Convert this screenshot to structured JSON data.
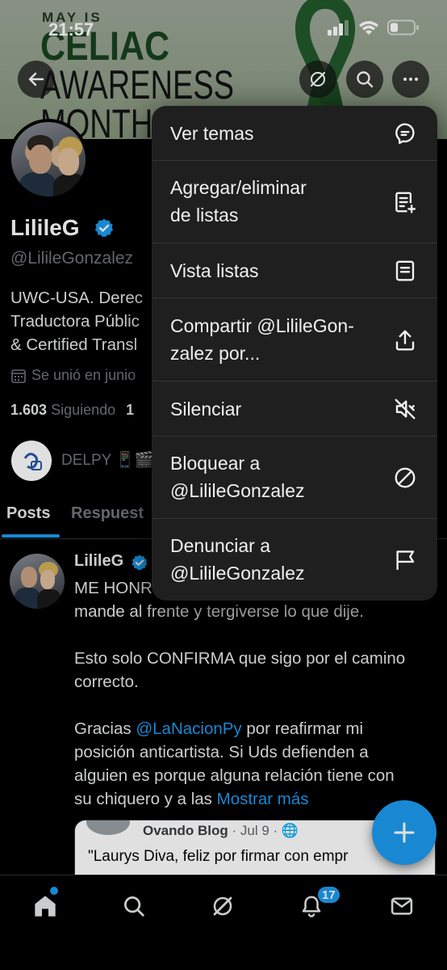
{
  "status_bar": {
    "time": "21:57"
  },
  "banner": {
    "line_small": "MAY IS",
    "line_1": "CELIAC",
    "line_2": "AWARENESS",
    "line_3": "MONTH"
  },
  "profile": {
    "name": "LilileG",
    "handle": "@LilileGonzalez",
    "bio_line_1": "UWC-USA. Derec",
    "bio_line_2": "Traductora Públic",
    "bio_line_3": "& Certified Transl",
    "joined": "Se unió en junio",
    "following_count": "1.603",
    "following_label": "Siguiendo",
    "followers_count_partial": "1",
    "followed_by_name": "DELPY 📱🎬"
  },
  "tabs": [
    {
      "label": "Posts"
    },
    {
      "label": "Respuest"
    }
  ],
  "post": {
    "author": "LilileG",
    "line_1": "ME HONR",
    "line_2": "mande al frente y tergiverse lo que dije.",
    "para_2_line_1": "Esto solo CONFIRMA que sigo por el camino",
    "para_2_line_2": "correcto.",
    "para_3_prefix": "Gracias ",
    "mention": "@LaNacionPy",
    "para_3_line_1_suffix": " por reafirmar mi",
    "para_3_line_2": "posición anticartista. Si Uds defienden a",
    "para_3_line_3": "alguien es porque alguna relación tiene con",
    "para_3_line_4_prefix": "su chiquero y a las ",
    "show_more": "Mostrar más",
    "embed": {
      "source": "Ovando Blog",
      "date": " · Jul 9 · ",
      "text": "\"Laurys Diva, feliz por firmar con empr"
    }
  },
  "menu": {
    "items": [
      {
        "label": "Ver temas",
        "icon": "topics-icon"
      },
      {
        "label": "Agregar/eliminar\nde listas",
        "icon": "add-to-list-icon"
      },
      {
        "label": "Vista listas",
        "icon": "lists-icon"
      },
      {
        "label": "Compartir @LilileGon-\nzalez por...",
        "icon": "share-icon"
      },
      {
        "label": "Silenciar",
        "icon": "mute-icon"
      },
      {
        "label": "Bloquear a\n@LilileGonzalez",
        "icon": "block-icon"
      },
      {
        "label": "Denunciar a\n@LilileGonzalez",
        "icon": "flag-icon"
      }
    ]
  },
  "bottom_nav": {
    "notifications_badge": "17"
  },
  "colors": {
    "accent": "#1d9bf0",
    "menu_bg": "#1f1f1f",
    "background": "#000000"
  }
}
